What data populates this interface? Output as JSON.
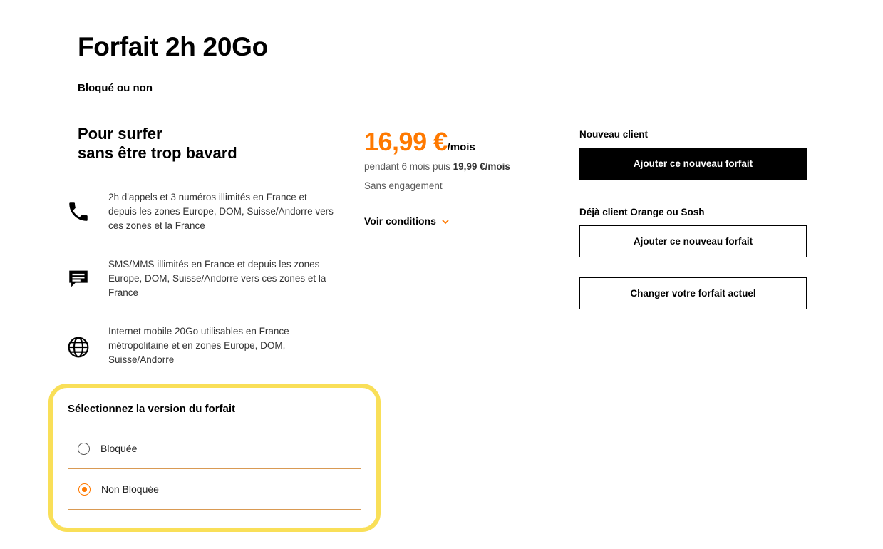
{
  "title": "Forfait 2h 20Go",
  "subtitle": "Bloqué ou non",
  "tagline": [
    "Pour surfer",
    "sans être trop bavard"
  ],
  "features": [
    {
      "icon": "phone-icon",
      "text": "2h d'appels et 3 numéros illimités en France et depuis les zones Europe, DOM, Suisse/Andorre vers ces zones et la France"
    },
    {
      "icon": "sms-icon",
      "text": "SMS/MMS illimités en France  et depuis les zones Europe, DOM, Suisse/Andorre vers ces zones et la France"
    },
    {
      "icon": "globe-icon",
      "text": "Internet mobile 20Go utilisables en France métropolitaine et en zones Europe, DOM, Suisse/Andorre"
    }
  ],
  "price": {
    "amount": "16,99 €",
    "unit": "/mois",
    "detail_prefix": "pendant 6 mois puis ",
    "detail_price": "19,99 €/mois",
    "commitment": "Sans engagement",
    "conditions_label": "Voir conditions"
  },
  "new_client": {
    "label": "Nouveau client",
    "button": "Ajouter ce nouveau forfait"
  },
  "existing_client": {
    "label": "Déjà client Orange ou Sosh",
    "add_button": "Ajouter ce nouveau forfait",
    "change_button": "Changer votre forfait actuel"
  },
  "version_selector": {
    "title": "Sélectionnez la version du forfait",
    "options": [
      {
        "label": "Bloquée",
        "selected": false
      },
      {
        "label": "Non Bloquée",
        "selected": true
      }
    ]
  },
  "colors": {
    "accent": "#ff7900",
    "highlight": "#f9df58",
    "selected_border": "#d99a54"
  }
}
